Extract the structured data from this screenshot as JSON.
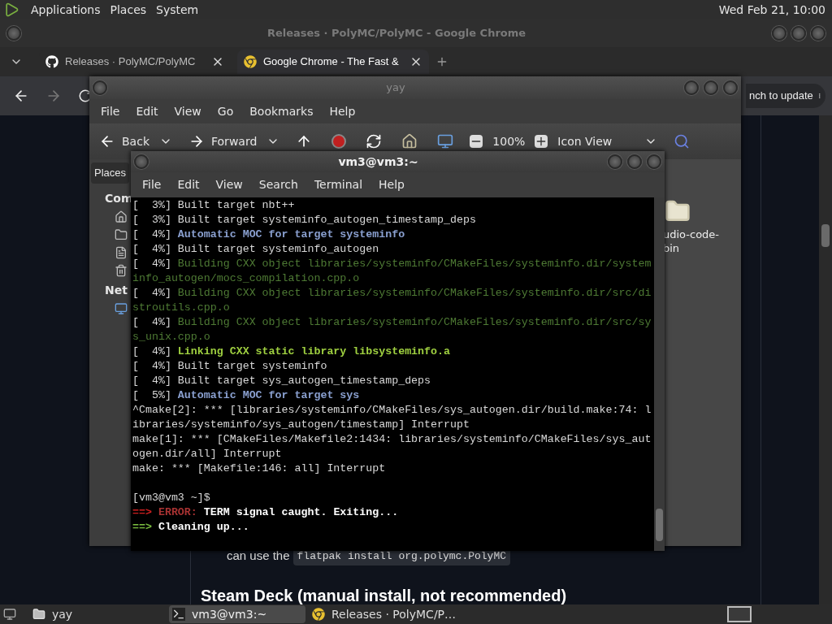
{
  "top_panel": {
    "menus": [
      "Applications",
      "Places",
      "System"
    ],
    "clock": "Wed Feb 21, 10:00"
  },
  "browser": {
    "title": "Releases · PolyMC/PolyMC - Google Chrome",
    "tabs": [
      {
        "label": "Releases · PolyMC/PolyMC",
        "selected": false,
        "kind": "github"
      },
      {
        "label": "Google Chrome - The Fast &",
        "selected": true,
        "kind": "chrome"
      }
    ],
    "update_button": "nch to update",
    "page": {
      "text_before_code": "can use the",
      "code": "flatpak install org.polymc.PolyMC",
      "heading": "Steam Deck (manual install, not recommended)"
    }
  },
  "file_manager": {
    "title": "yay",
    "menu": [
      "File",
      "Edit",
      "View",
      "Go",
      "Bookmarks",
      "Help"
    ],
    "toolbar": {
      "back": "Back",
      "forward": "Forward",
      "zoom": "100%",
      "view": "Icon View"
    },
    "sidebar": {
      "tab": "Places",
      "sections": [
        "Com",
        "Net"
      ]
    },
    "files": [
      {
        "name": "udio-code-bin"
      }
    ]
  },
  "terminal": {
    "title": "vm3@vm3:~",
    "menu": [
      "File",
      "Edit",
      "View",
      "Search",
      "Terminal",
      "Help"
    ],
    "lines": [
      {
        "segments": [
          {
            "kind": "plain",
            "text": "[  3%] Built target nbt++"
          }
        ]
      },
      {
        "segments": [
          {
            "kind": "plain",
            "text": "[  3%] Built target systeminfo_autogen_timestamp_deps"
          }
        ]
      },
      {
        "segments": [
          {
            "kind": "plain",
            "text": "[  4%] "
          },
          {
            "kind": "moc",
            "text": "Automatic MOC for target systeminfo"
          }
        ]
      },
      {
        "segments": [
          {
            "kind": "plain",
            "text": "[  4%] Built target systeminfo_autogen"
          }
        ]
      },
      {
        "segments": [
          {
            "kind": "plain",
            "text": "[  4%] "
          },
          {
            "kind": "build",
            "text": "Building CXX object libraries/systeminfo/CMakeFiles/systeminfo.dir/system"
          }
        ]
      },
      {
        "segments": [
          {
            "kind": "build",
            "text": "info_autogen/mocs_compilation.cpp.o"
          }
        ]
      },
      {
        "segments": [
          {
            "kind": "plain",
            "text": "[  4%] "
          },
          {
            "kind": "build",
            "text": "Building CXX object libraries/systeminfo/CMakeFiles/systeminfo.dir/src/di"
          }
        ]
      },
      {
        "segments": [
          {
            "kind": "build",
            "text": "stroutils.cpp.o"
          }
        ]
      },
      {
        "segments": [
          {
            "kind": "plain",
            "text": "[  4%] "
          },
          {
            "kind": "build",
            "text": "Building CXX object libraries/systeminfo/CMakeFiles/systeminfo.dir/src/sy"
          }
        ]
      },
      {
        "segments": [
          {
            "kind": "build",
            "text": "s_unix.cpp.o"
          }
        ]
      },
      {
        "segments": [
          {
            "kind": "plain",
            "text": "[  4%] "
          },
          {
            "kind": "link",
            "text": "Linking CXX static library libsysteminfo.a"
          }
        ]
      },
      {
        "segments": [
          {
            "kind": "plain",
            "text": "[  4%] Built target systeminfo"
          }
        ]
      },
      {
        "segments": [
          {
            "kind": "plain",
            "text": "[  4%] Built target sys_autogen_timestamp_deps"
          }
        ]
      },
      {
        "segments": [
          {
            "kind": "plain",
            "text": "[  5%] "
          },
          {
            "kind": "moc",
            "text": "Automatic MOC for target sys"
          }
        ]
      },
      {
        "segments": [
          {
            "kind": "plain",
            "text": "^Cmake[2]: *** [libraries/systeminfo/CMakeFiles/sys_autogen.dir/build.make:74: l"
          }
        ]
      },
      {
        "segments": [
          {
            "kind": "plain",
            "text": "ibraries/systeminfo/sys_autogen/timestamp] Interrupt"
          }
        ]
      },
      {
        "segments": [
          {
            "kind": "plain",
            "text": "make[1]: *** [CMakeFiles/Makefile2:1434: libraries/systeminfo/CMakeFiles/sys_aut"
          }
        ]
      },
      {
        "segments": [
          {
            "kind": "plain",
            "text": "ogen.dir/all] Interrupt"
          }
        ]
      },
      {
        "segments": [
          {
            "kind": "plain",
            "text": "make: *** [Makefile:146: all] Interrupt"
          }
        ]
      },
      {
        "spaced": true,
        "segments": [
          {
            "kind": "plain",
            "text": "[vm3@vm3 ~]$"
          }
        ]
      },
      {
        "segments": [
          {
            "kind": "err_arrow",
            "text": "==> "
          },
          {
            "kind": "err_label",
            "text": "ERROR:"
          },
          {
            "kind": "bold",
            "text": " TERM signal caught. Exiting..."
          }
        ]
      },
      {
        "segments": [
          {
            "kind": "ok_arrow",
            "text": "==> "
          },
          {
            "kind": "bold",
            "text": "Cleaning up..."
          }
        ]
      }
    ]
  },
  "taskbar": {
    "tasks": [
      {
        "label": "yay",
        "selected": false,
        "kind": "folder"
      },
      {
        "label": "vm3@vm3:~",
        "selected": true,
        "kind": "terminal"
      },
      {
        "label": "Releases · PolyMC/P…",
        "selected": false,
        "kind": "chrome"
      }
    ]
  }
}
